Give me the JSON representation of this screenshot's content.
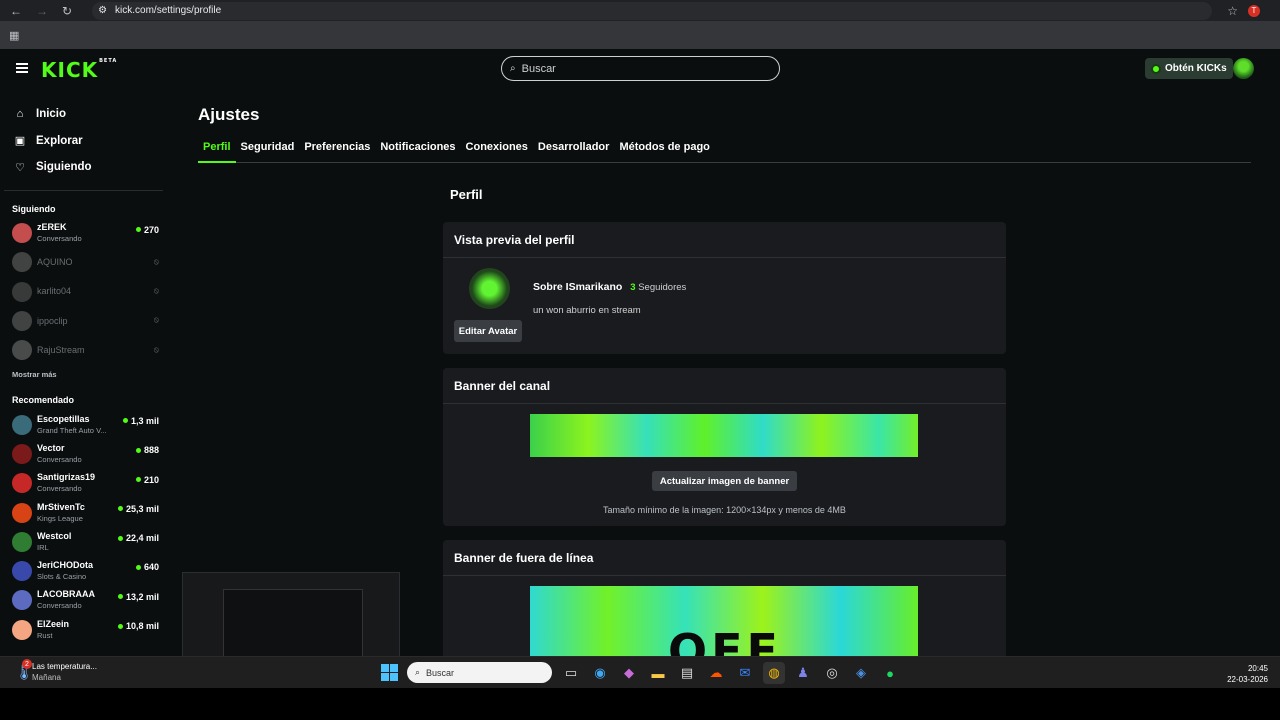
{
  "browser": {
    "url": "kick.com/settings/profile",
    "profile_initial": "T"
  },
  "header": {
    "logo": "KICK",
    "logo_badge": "BETA",
    "search_placeholder": "Buscar",
    "get_kicks_label": "Obtén KICKs"
  },
  "sidebar": {
    "nav": [
      {
        "label": "Inicio",
        "icon": "home-icon"
      },
      {
        "label": "Explorar",
        "icon": "explore-icon"
      },
      {
        "label": "Siguiendo",
        "icon": "heart-icon"
      }
    ],
    "following_title": "Siguiendo",
    "following": [
      {
        "name": "zEREK",
        "sub": "Conversando",
        "count": "270",
        "live": true,
        "color": "#c44d4d"
      },
      {
        "name": "AQUINO",
        "live": false,
        "color": "#777"
      },
      {
        "name": "karlito04",
        "live": false,
        "color": "#666"
      },
      {
        "name": "ippoclip",
        "live": false,
        "color": "#777"
      },
      {
        "name": "RajuStream",
        "live": false,
        "color": "#888"
      }
    ],
    "show_more": "Mostrar más",
    "recommended_title": "Recomendado",
    "recommended": [
      {
        "name": "Escopetillas",
        "sub": "Grand Theft Auto V...",
        "count": "1,3 mil",
        "color": "#3a6b7a"
      },
      {
        "name": "Vector",
        "sub": "Conversando",
        "count": "888",
        "color": "#7a1a1a"
      },
      {
        "name": "Santigrizas19",
        "sub": "Conversando",
        "count": "210",
        "color": "#c62828"
      },
      {
        "name": "MrStivenTc",
        "sub": "Kings League",
        "count": "25,3 mil",
        "color": "#d84315"
      },
      {
        "name": "Westcol",
        "sub": "IRL",
        "count": "22,4 mil",
        "color": "#2e7d32"
      },
      {
        "name": "JeriCHODota",
        "sub": "Slots & Casino",
        "count": "640",
        "color": "#3949ab"
      },
      {
        "name": "LACOBRAAA",
        "sub": "Conversando",
        "count": "13,2 mil",
        "color": "#5c6bc0"
      },
      {
        "name": "ElZeein",
        "sub": "Rust",
        "count": "10,8 mil",
        "color": "#f4a582"
      }
    ]
  },
  "settings": {
    "title": "Ajustes",
    "tabs": [
      "Perfil",
      "Seguridad",
      "Preferencias",
      "Notificaciones",
      "Conexiones",
      "Desarrollador",
      "Métodos de pago"
    ],
    "section_title": "Perfil",
    "preview_card": {
      "title": "Vista previa del perfil",
      "about": "Sobre ISmarikano",
      "followers_count": "3",
      "followers_label": "Seguidores",
      "bio": "un won aburrio en stream",
      "edit_avatar": "Editar Avatar"
    },
    "banner_card": {
      "title": "Banner del canal",
      "update_button": "Actualizar imagen de banner",
      "hint": "Tamaño mínimo de la imagen: 1200×134px y menos de 4MB"
    },
    "offline_card": {
      "title": "Banner de fuera de línea",
      "image_text": "OFF"
    }
  },
  "taskbar": {
    "weather_title": "Las temperatura...",
    "weather_sub": "Mañana",
    "weather_badge": "2",
    "search_label": "Buscar",
    "time": "20:45",
    "date": "22-03-2026"
  }
}
